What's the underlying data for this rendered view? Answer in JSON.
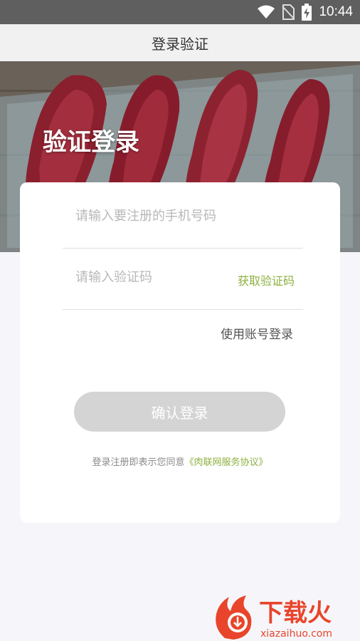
{
  "status_bar": {
    "time": "10:44"
  },
  "header": {
    "title": "登录验证"
  },
  "hero": {
    "title": "验证登录"
  },
  "form": {
    "phone_placeholder": "请输入要注册的手机号码",
    "code_placeholder": "请输入验证码",
    "get_code_label": "获取验证码",
    "account_login_label": "使用账号登录",
    "confirm_label": "确认登录"
  },
  "agreement": {
    "prefix": "登录注册即表示您同意",
    "link": "《肉联网服务协议》"
  },
  "watermark": {
    "brand": "下载火",
    "domain": "xiazaihuo.com"
  },
  "colors": {
    "accent_green": "#8cb03f",
    "button_disabled": "#d4d4d4",
    "watermark_red": "#e8452c"
  }
}
